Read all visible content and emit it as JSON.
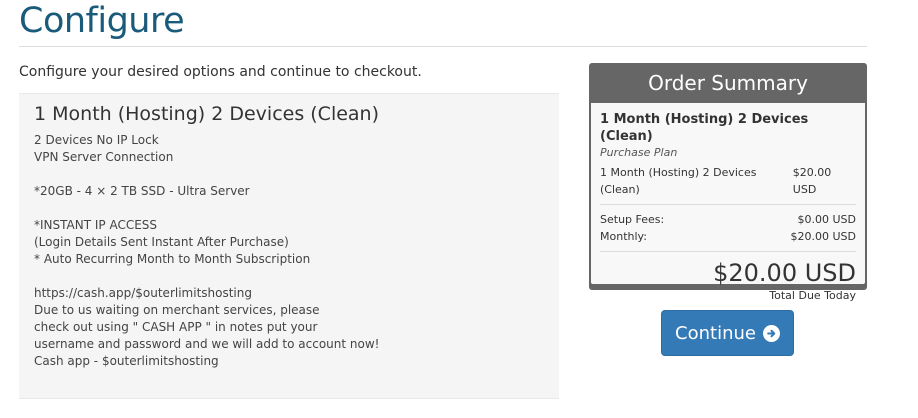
{
  "page": {
    "title": "Configure",
    "intro": "Configure your desired options and continue to checkout."
  },
  "product": {
    "name": "1 Month (Hosting) 2 Devices (Clean)",
    "description_lines": [
      "2 Devices No IP Lock",
      "VPN Server Connection",
      "",
      "*20GB - 4 × 2 TB SSD - Ultra Server",
      "",
      "*INSTANT IP ACCESS",
      "(Login Details Sent Instant After Purchase)",
      "* Auto Recurring Month to Month Subscription",
      "",
      "https://cash.app/$outerlimitshosting",
      "Due to us waiting on merchant services, please",
      "check out using \" CASH APP \" in notes put your",
      "username and password and we will add to account now!",
      "Cash app - $outerlimitshosting"
    ]
  },
  "summary": {
    "heading": "Order Summary",
    "product_name": "1 Month (Hosting) 2 Devices (Clean)",
    "product_group": "Purchase Plan",
    "line_item": {
      "label": "1 Month (Hosting) 2 Devices (Clean)",
      "amount": "$20.00 USD"
    },
    "setup_fees": {
      "label": "Setup Fees:",
      "amount": "$0.00 USD"
    },
    "monthly": {
      "label": "Monthly:",
      "amount": "$20.00 USD"
    },
    "total_amount": "$20.00 USD",
    "total_label": "Total Due Today"
  },
  "actions": {
    "continue_label": "Continue",
    "continue_icon": "arrow-circle-right-icon"
  },
  "colors": {
    "title": "#1a5a7a",
    "summary_header": "#666666",
    "button": "#337ab7"
  }
}
